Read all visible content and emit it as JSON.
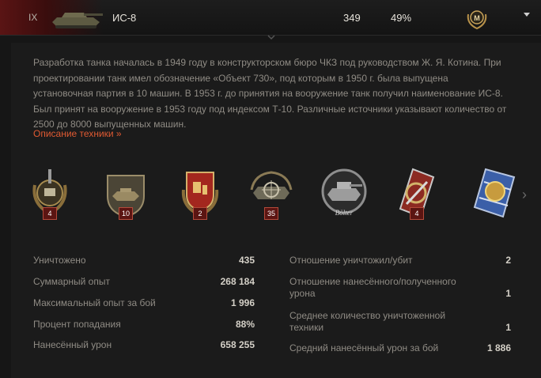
{
  "header": {
    "tier": "IX",
    "tank_name": "ИС-8",
    "battles": "349",
    "win_rate": "49%",
    "mastery_badge_letter": "M",
    "flag_color": "#5a1414"
  },
  "description": {
    "text": "Разработка танка началась в 1949 году в конструкторском бюро ЧКЗ под руководством Ж. Я. Котина. При проектировании танк имел обозначение «Объект 730», под которым в 1950 г. была выпущена установочная партия в 10 машин. В 1953 г. до принятия на вооружение танк получил наименование ИС-8. Был принят на вооружение в 1953 году под индексом Т-10. Различные источники указывают количество от 2500 до 8000 выпущенных машин.",
    "link_label": "Описание техники »",
    "link_color": "#e05a32"
  },
  "medals": [
    {
      "name": "medal-tank-laurel",
      "count": "4"
    },
    {
      "name": "medal-tank-shield",
      "count": "10"
    },
    {
      "name": "medal-red-banner",
      "count": "2"
    },
    {
      "name": "medal-crosshair-tank",
      "count": "35"
    },
    {
      "name": "medal-bolter",
      "label": "Bölter",
      "count": ""
    },
    {
      "name": "medal-red-sword",
      "count": "4"
    },
    {
      "name": "medal-lion",
      "count": ""
    }
  ],
  "stats_left": [
    {
      "label": "Уничтожено",
      "value": "435"
    },
    {
      "label": "Суммарный опыт",
      "value": "268 184"
    },
    {
      "label": "Максимальный опыт за бой",
      "value": "1 996"
    },
    {
      "label": "Процент попадания",
      "value": "88%"
    },
    {
      "label": "Нанесённый урон",
      "value": "658 255"
    }
  ],
  "stats_right": [
    {
      "label": "Отношение уничтожил/убит",
      "value": "2"
    },
    {
      "label": "Отношение нанесённого/полученного урона",
      "value": "1"
    },
    {
      "label": "Среднее количество уничтоженной техники",
      "value": "1"
    },
    {
      "label": "Средний нанесённый урон за бой",
      "value": "1 886"
    }
  ]
}
